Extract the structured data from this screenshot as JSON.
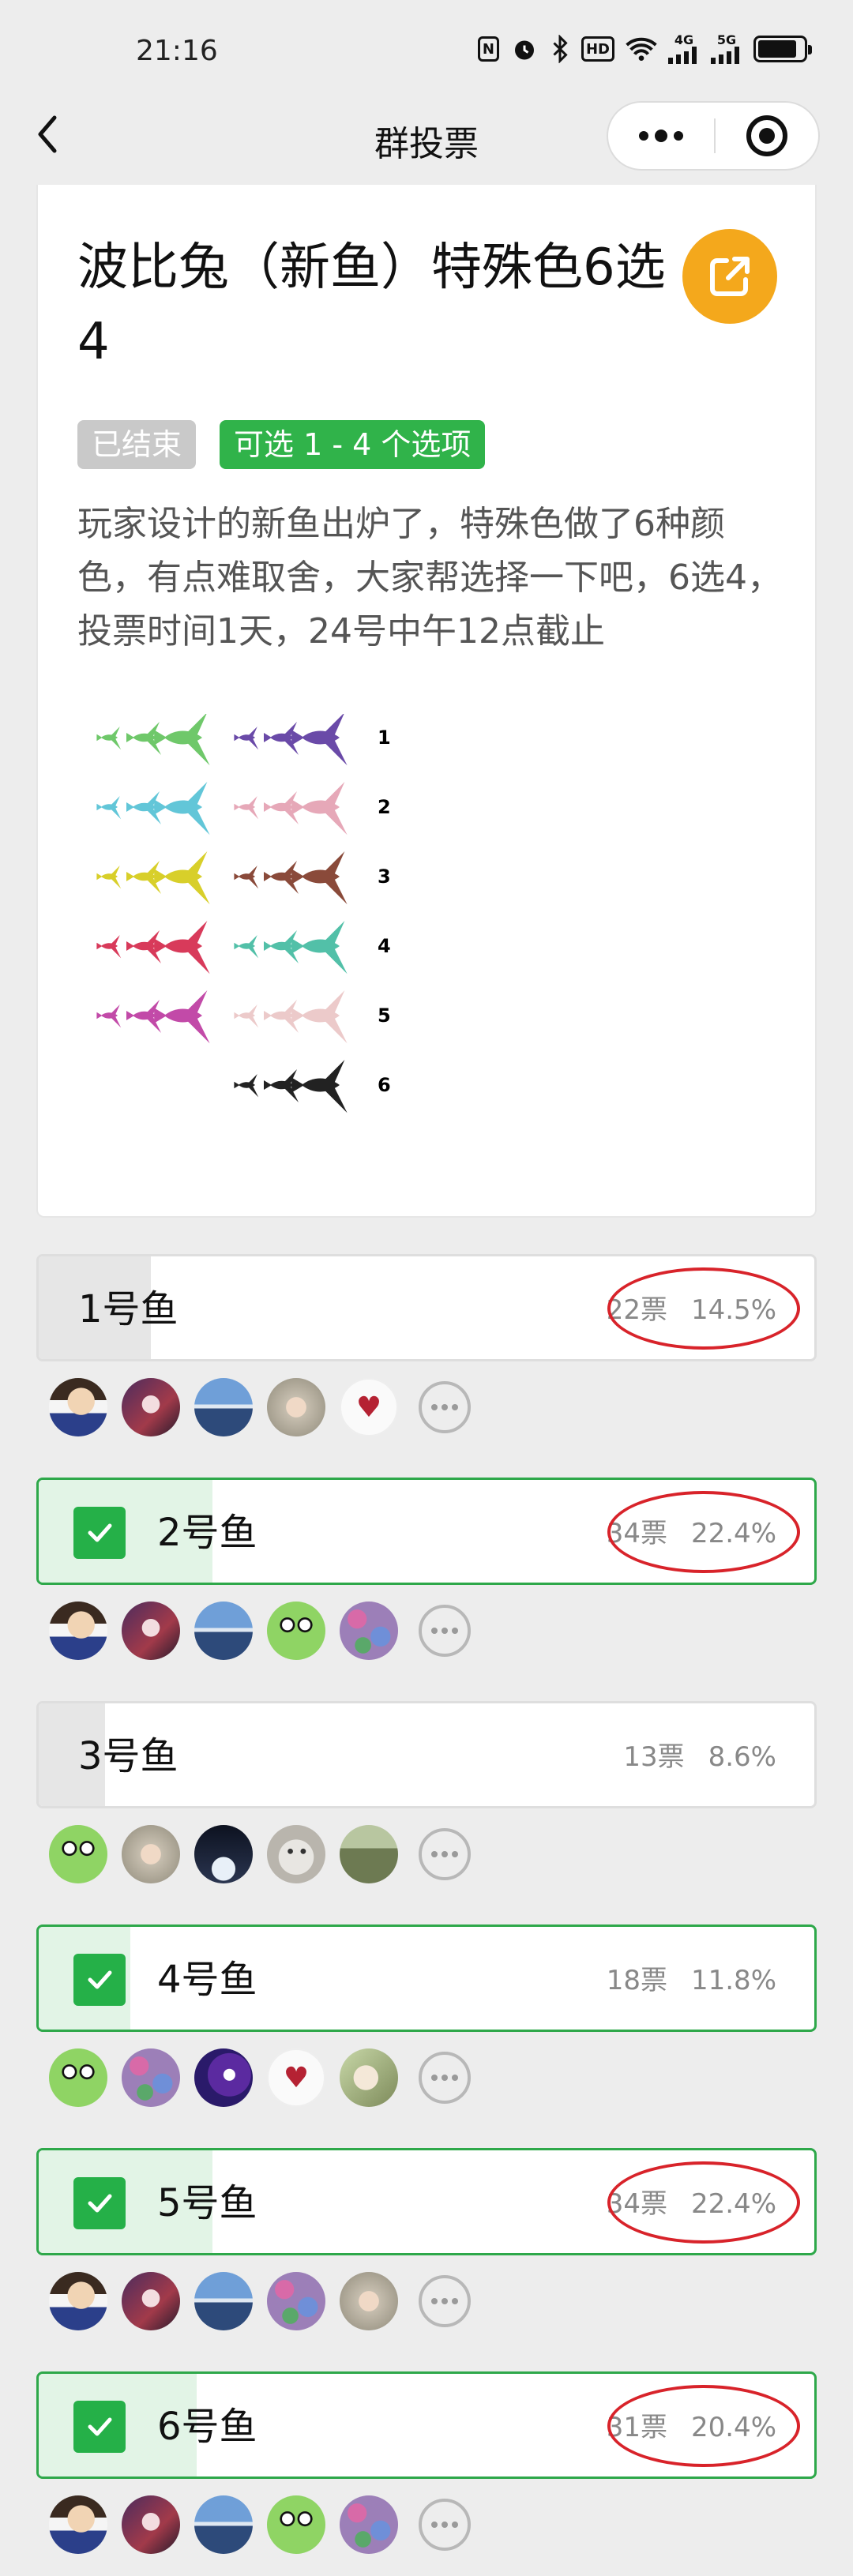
{
  "status_bar": {
    "time": "21:16",
    "nfc_label": "N",
    "hd_label": "HD",
    "net1_label": "4G",
    "net2_label": "5G"
  },
  "nav": {
    "title": "群投票"
  },
  "poll": {
    "title": "波比兔（新鱼）特殊色6选4",
    "status_tag": "已结束",
    "rule_tag": "可选 1 - 4 个选项",
    "description": "玩家设计的新鱼出炉了，特殊色做了6种颜色，有点难取舍，大家帮选择一下吧，6选4，投票时间1天，24号中午12点截止",
    "image_labels": [
      "1",
      "2",
      "3",
      "4",
      "5",
      "6"
    ]
  },
  "options": [
    {
      "label": "1号鱼",
      "votes": "22票",
      "percent": "14.5%",
      "percent_value": 14.5,
      "selected": false,
      "circled": true,
      "voters": [
        "avatar-boy",
        "avatar-anime",
        "avatar-sky",
        "avatar-girl",
        "avatar-heart"
      ]
    },
    {
      "label": "2号鱼",
      "votes": "34票",
      "percent": "22.4%",
      "percent_value": 22.4,
      "selected": true,
      "circled": true,
      "voters": [
        "avatar-boy",
        "avatar-anime",
        "avatar-sky",
        "avatar-frog",
        "avatar-flower"
      ]
    },
    {
      "label": "3号鱼",
      "votes": "13票",
      "percent": "8.6%",
      "percent_value": 8.6,
      "selected": false,
      "circled": false,
      "voters": [
        "avatar-frog",
        "avatar-girl",
        "avatar-night",
        "avatar-cat",
        "avatar-garden"
      ]
    },
    {
      "label": "4号鱼",
      "votes": "18票",
      "percent": "11.8%",
      "percent_value": 11.8,
      "selected": true,
      "circled": false,
      "voters": [
        "avatar-frog",
        "avatar-flower",
        "avatar-ball",
        "avatar-heart",
        "avatar-snow"
      ]
    },
    {
      "label": "5号鱼",
      "votes": "34票",
      "percent": "22.4%",
      "percent_value": 22.4,
      "selected": true,
      "circled": true,
      "voters": [
        "avatar-boy",
        "avatar-anime",
        "avatar-sky",
        "avatar-flower",
        "avatar-girl"
      ]
    },
    {
      "label": "6号鱼",
      "votes": "31票",
      "percent": "20.4%",
      "percent_value": 20.4,
      "selected": true,
      "circled": true,
      "voters": [
        "avatar-boy",
        "avatar-anime",
        "avatar-sky",
        "avatar-frog",
        "avatar-flower"
      ]
    }
  ],
  "colors": {
    "accent_green": "#25b048",
    "share_orange": "#f4a81c",
    "annotation_red": "#d8232a"
  },
  "icons": {
    "back": "back-arrow-icon",
    "more": "more-dots-icon",
    "close": "target-close-icon",
    "share": "share-icon",
    "check": "checkmark-icon",
    "more_voters": "more-voters-icon"
  }
}
